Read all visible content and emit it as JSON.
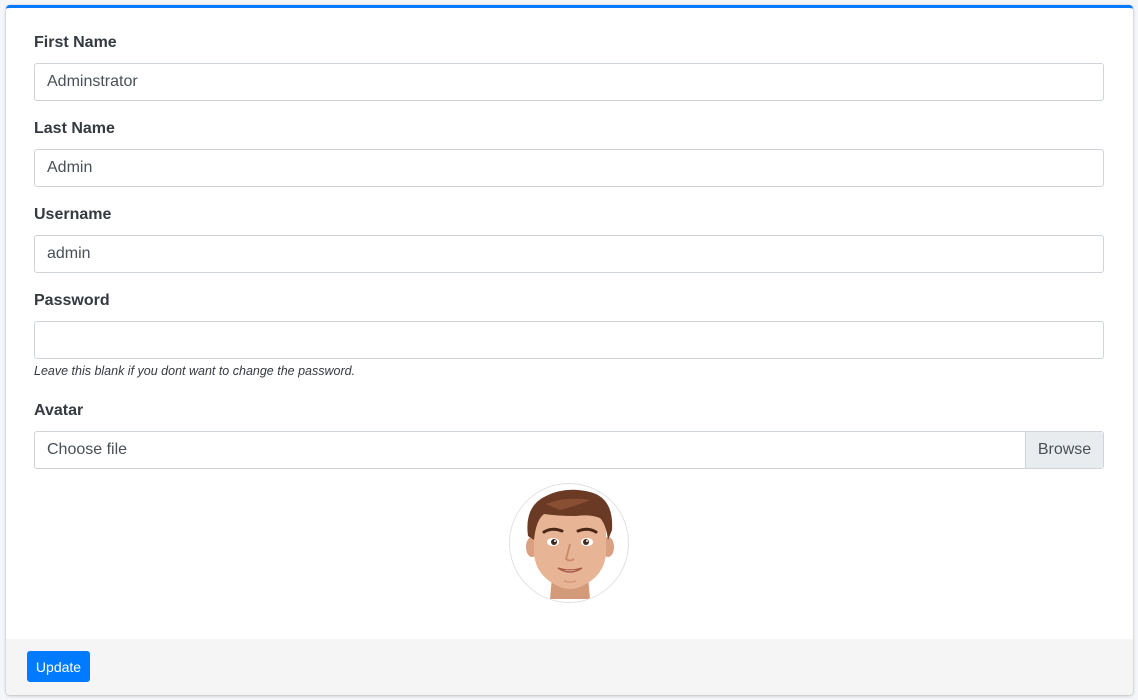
{
  "form": {
    "first_name": {
      "label": "First Name",
      "value": "Adminstrator"
    },
    "last_name": {
      "label": "Last Name",
      "value": "Admin"
    },
    "username": {
      "label": "Username",
      "value": "admin"
    },
    "password": {
      "label": "Password",
      "value": "",
      "help": "Leave this blank if you dont want to change the password."
    },
    "avatar": {
      "label": "Avatar",
      "file_placeholder": "Choose file",
      "browse_label": "Browse"
    }
  },
  "footer": {
    "update_label": "Update"
  },
  "colors": {
    "accent": "#007bff",
    "footer_bg": "#f5f5f5"
  }
}
